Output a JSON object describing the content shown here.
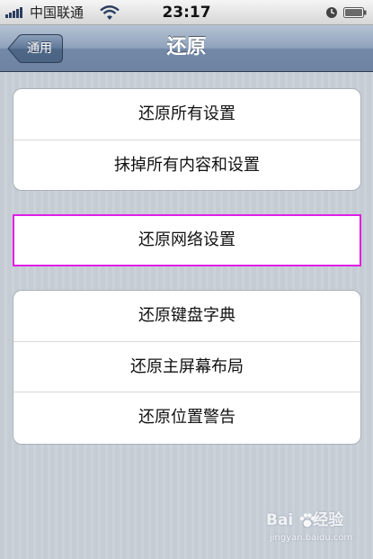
{
  "status_bar": {
    "carrier": "中国联通",
    "time": "23:17"
  },
  "nav_bar": {
    "back_label": "通用",
    "title": "还原"
  },
  "groups": [
    {
      "items": [
        {
          "label": "还原所有设置"
        },
        {
          "label": "抹掉所有内容和设置"
        }
      ]
    },
    {
      "items": [
        {
          "label": "还原网络设置",
          "highlighted": true
        }
      ]
    },
    {
      "items": [
        {
          "label": "还原键盘字典"
        },
        {
          "label": "还原主屏幕布局"
        },
        {
          "label": "还原位置警告"
        }
      ]
    }
  ],
  "watermark": {
    "logo_prefix": "Bai",
    "logo_suffix": "经验",
    "url": "jingyan.baidu.com"
  },
  "icons": {
    "signal": "signal-bars-icon",
    "wifi": "wifi-icon",
    "clock_lock": "orientation-lock-icon",
    "battery": "battery-icon",
    "back": "back-arrow-icon"
  },
  "colors": {
    "nav_bar": "#7389a8",
    "highlight_border": "#e11ee6",
    "background": "#c5ccd4"
  }
}
